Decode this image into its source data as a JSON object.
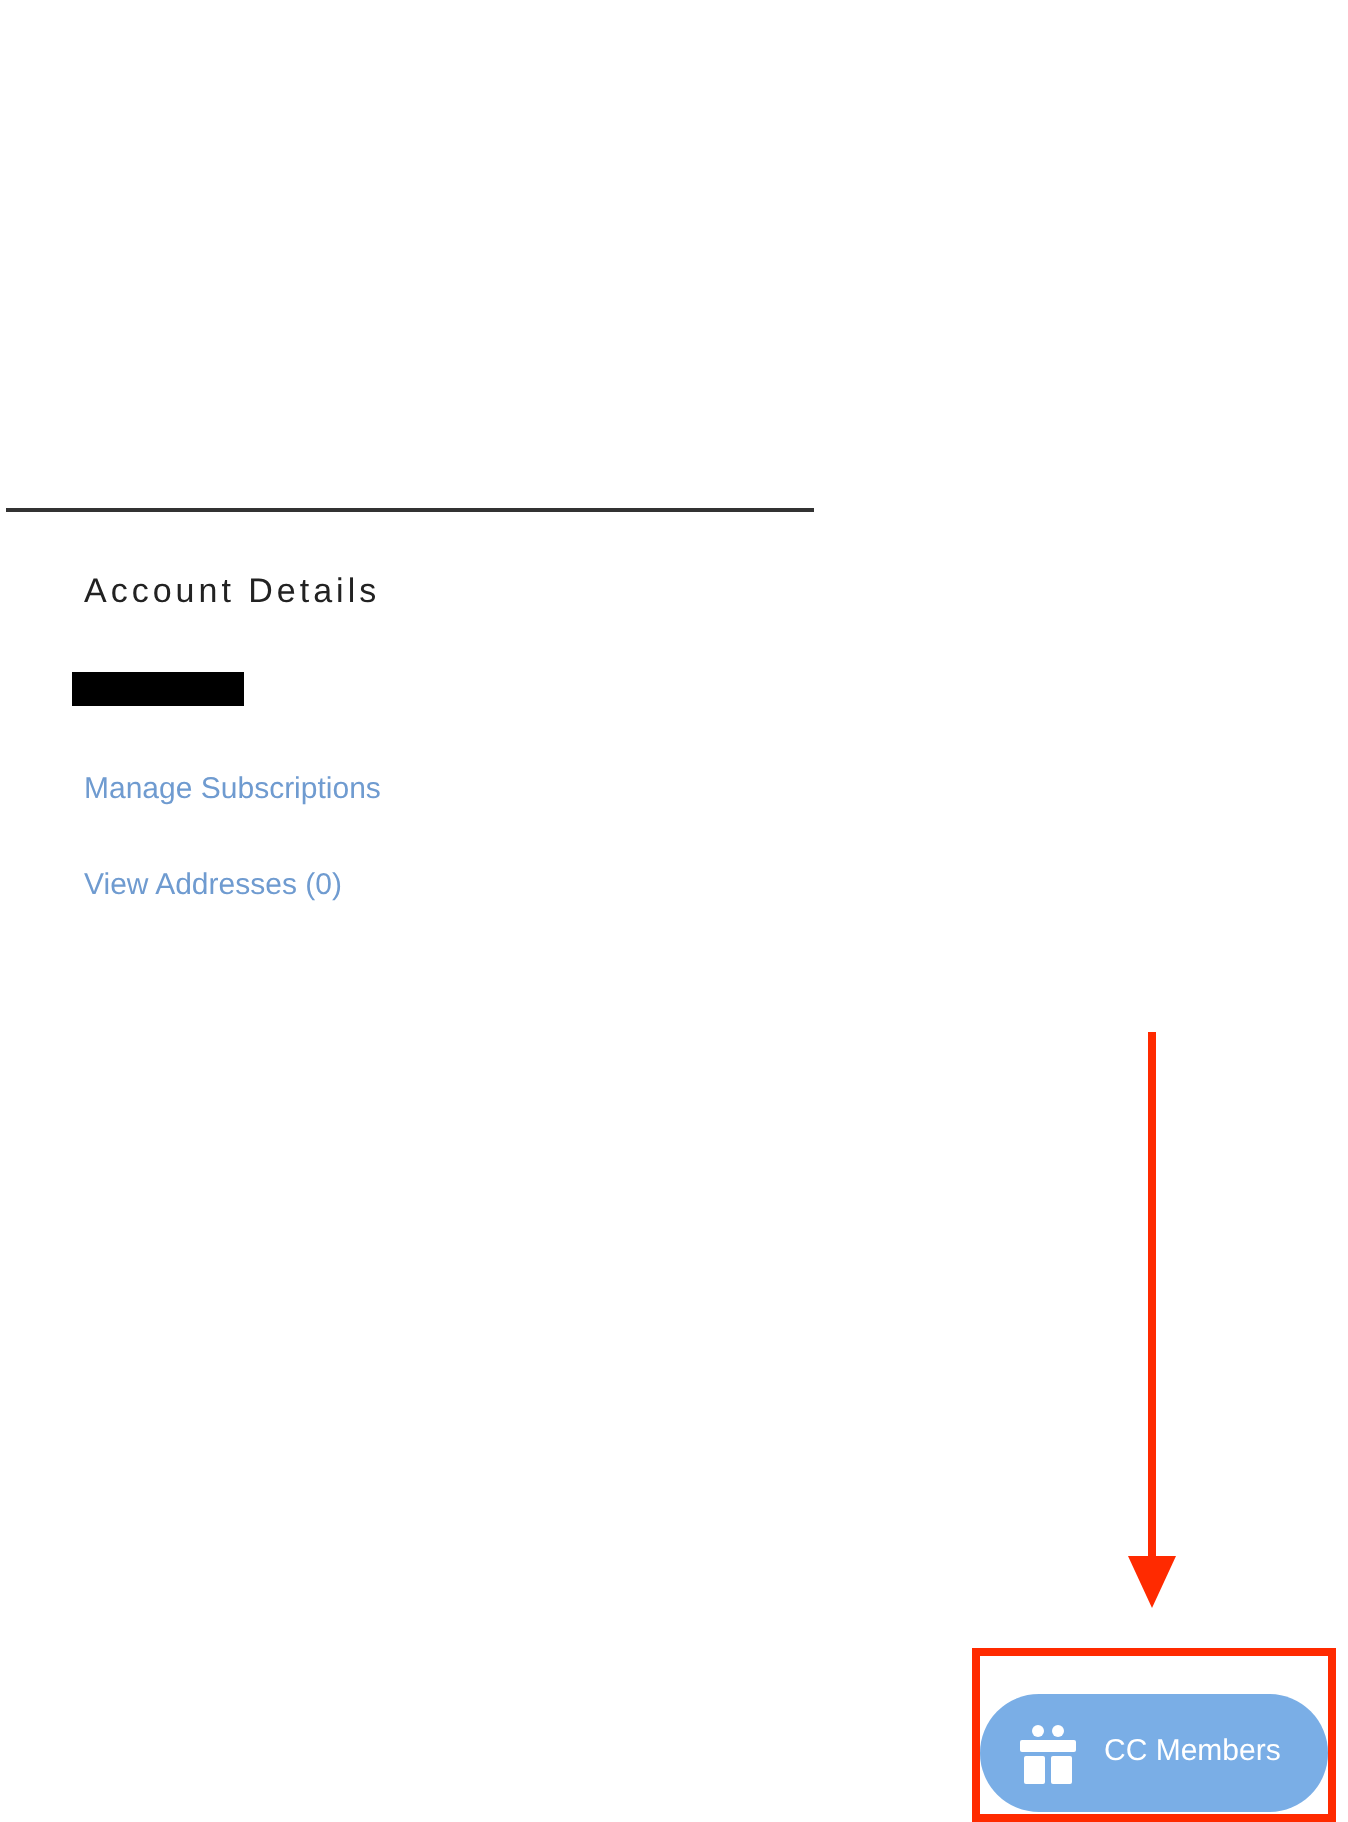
{
  "account_details": {
    "title": "Account Details",
    "links": [
      {
        "label": "Manage Subscriptions"
      },
      {
        "label": "View Addresses (0)"
      }
    ]
  },
  "floating_button": {
    "label": "CC Members"
  }
}
